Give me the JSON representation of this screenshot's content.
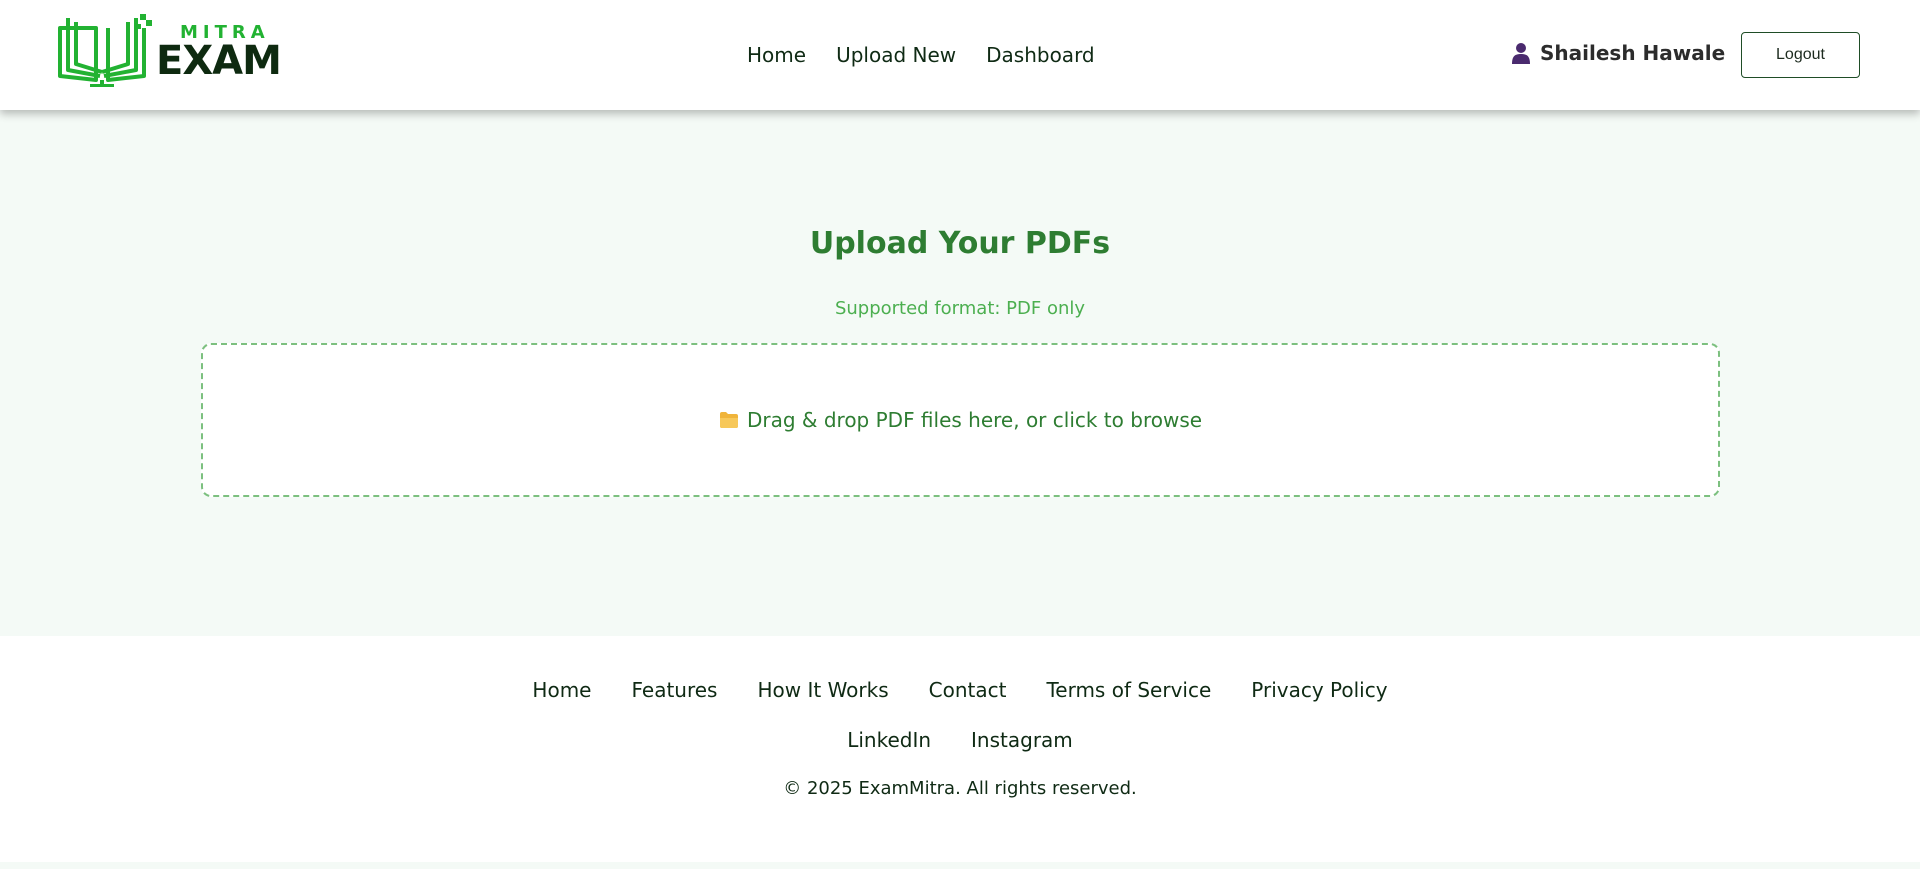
{
  "brand": {
    "top_word": "MITRA",
    "main_word": "EXAM",
    "primary_color": "#22b232",
    "dark_color": "#0e2a10"
  },
  "nav": {
    "items": [
      {
        "label": "Home"
      },
      {
        "label": "Upload New"
      },
      {
        "label": "Dashboard"
      }
    ]
  },
  "user": {
    "icon": "user-icon",
    "name": "Shailesh Hawale",
    "logout_label": "Logout"
  },
  "upload": {
    "title": "Upload Your PDFs",
    "subtitle": "Supported format: PDF only",
    "dropzone_icon": "folder-icon",
    "dropzone_text": "Drag & drop PDF files here, or click to browse",
    "accent_color": "#2e7d32"
  },
  "footer": {
    "links_row1": [
      {
        "label": "Home"
      },
      {
        "label": "Features"
      },
      {
        "label": "How It Works"
      },
      {
        "label": "Contact"
      },
      {
        "label": "Terms of Service"
      },
      {
        "label": "Privacy Policy"
      }
    ],
    "links_row2": [
      {
        "label": "LinkedIn"
      },
      {
        "label": "Instagram"
      }
    ],
    "copyright": "© 2025 ExamMitra. All rights reserved."
  }
}
